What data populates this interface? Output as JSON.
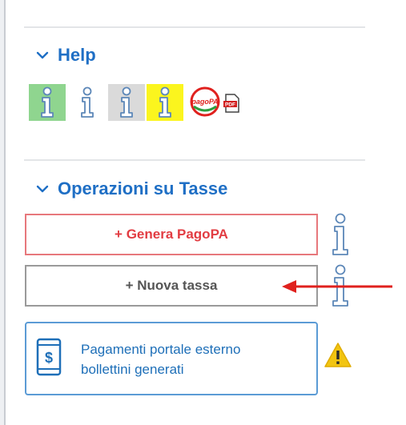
{
  "help": {
    "title": "Help",
    "icons": [
      "info-icon-green",
      "info-icon-plain",
      "info-icon-grey",
      "info-icon-yellow",
      "pagopa-icon",
      "pdf-icon"
    ]
  },
  "operations": {
    "title": "Operazioni su Tasse",
    "genera_label": "+ Genera PagoPA",
    "nuova_label": "+ Nuova tassa",
    "payments_line1": "Pagamenti portale esterno",
    "payments_line2": "bollettini generati",
    "pagopa_badge": "pagoPA",
    "pdf_badge": "PDF"
  },
  "colors": {
    "accent_blue": "#1f6fc5",
    "genera_red": "#e23c42",
    "arrow_red": "#e0211e",
    "warning_yellow": "#f2c511"
  }
}
